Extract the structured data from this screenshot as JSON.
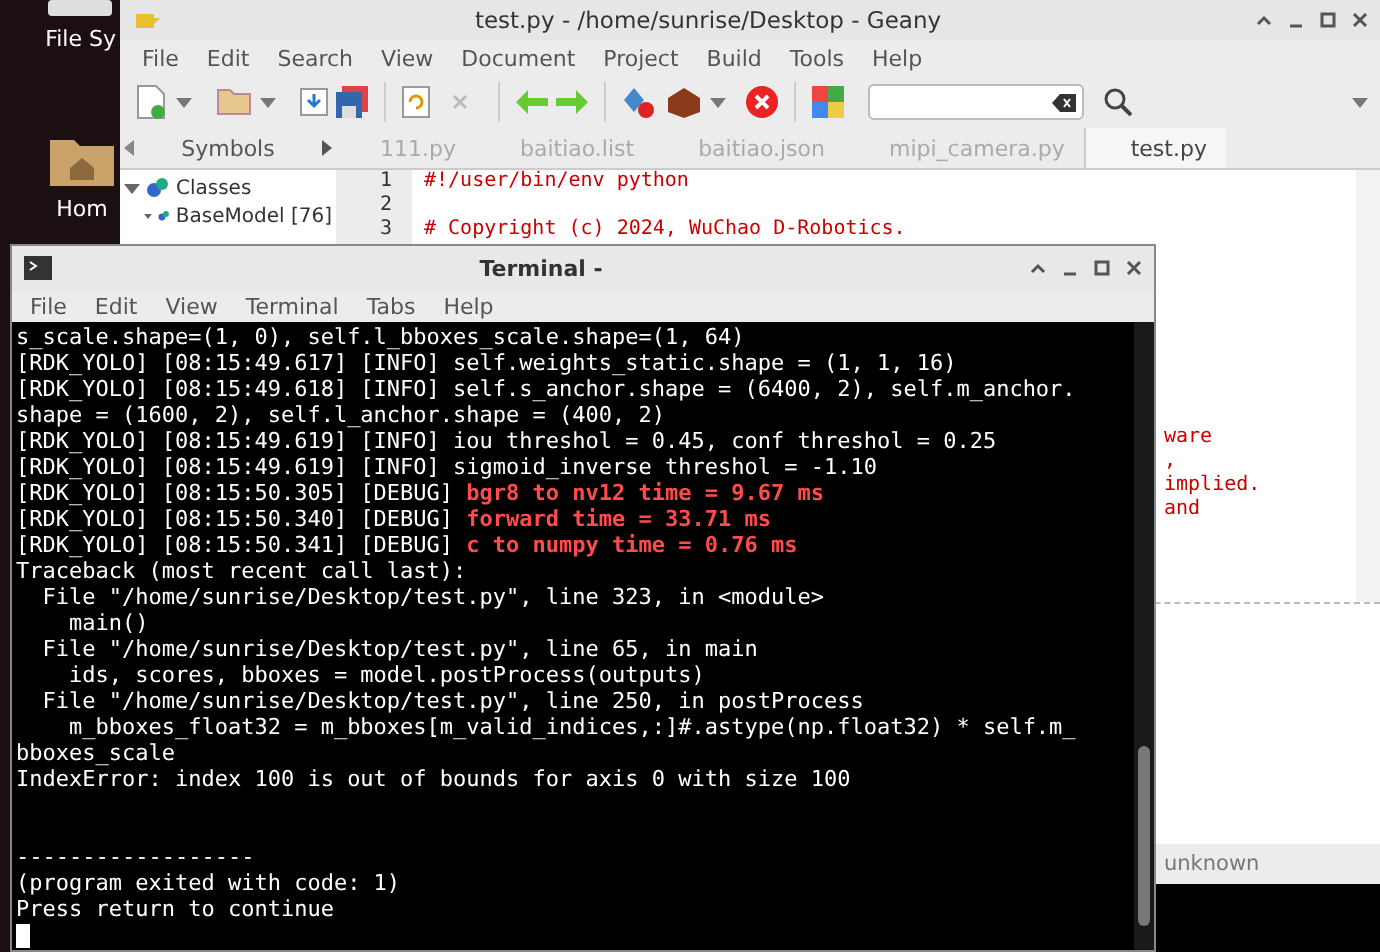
{
  "desktop": {
    "icons": [
      {
        "label": "File Sy",
        "kind": "drive"
      },
      {
        "label": "Hom",
        "kind": "home"
      }
    ]
  },
  "geany": {
    "title": "test.py - /home/sunrise/Desktop - Geany",
    "menu": [
      "File",
      "Edit",
      "Search",
      "View",
      "Document",
      "Project",
      "Build",
      "Tools",
      "Help"
    ],
    "sidebar": {
      "tab": "Symbols",
      "tree": [
        {
          "label": "Classes",
          "expanded": true,
          "children": [
            {
              "label": "BaseModel [76]",
              "expanded": true
            }
          ]
        }
      ]
    },
    "tabs": [
      {
        "label": "111.py",
        "selected": false
      },
      {
        "label": "baitiao.list",
        "selected": false
      },
      {
        "label": "baitiao.json",
        "selected": false
      },
      {
        "label": "mipi_camera.py",
        "selected": false
      },
      {
        "label": "test.py",
        "selected": true
      }
    ],
    "editor": {
      "lines": [
        {
          "number": "1",
          "code": "#!/user/bin/env python"
        },
        {
          "number": "2"
        },
        {
          "number": "3",
          "code": "# Copyright (c) 2024, WuChao D-Robotics."
        }
      ],
      "fragments": [
        "ware",
        ",",
        "implied.",
        "and"
      ]
    },
    "status": "unknown"
  },
  "terminal": {
    "title": "Terminal -",
    "menu": [
      "File",
      "Edit",
      "View",
      "Terminal",
      "Tabs",
      "Help"
    ],
    "lines": [
      {
        "text": "s_scale.shape=(1, 0), self.l_bboxes_scale.shape=(1, 64)"
      },
      {
        "text": "[RDK_YOLO] [08:15:49.617] [INFO] self.weights_static.shape = (1, 1, 16)"
      },
      {
        "text": "[RDK_YOLO] [08:15:49.618] [INFO] self.s_anchor.shape = (6400, 2), self.m_anchor."
      },
      {
        "text": "shape = (1600, 2), self.l_anchor.shape = (400, 2)"
      },
      {
        "text": "[RDK_YOLO] [08:15:49.619] [INFO] iou threshol = 0.45, conf threshol = 0.25"
      },
      {
        "text": "[RDK_YOLO] [08:15:49.619] [INFO] sigmoid_inverse threshol = -1.10"
      },
      {
        "text": "[RDK_YOLO] [08:15:50.305] [DEBUG] ",
        "highlight": "bgr8 to nv12 time = 9.67 ms"
      },
      {
        "text": "[RDK_YOLO] [08:15:50.340] [DEBUG] ",
        "highlight": "forward time = 33.71 ms"
      },
      {
        "text": "[RDK_YOLO] [08:15:50.341] [DEBUG] ",
        "highlight": "c to numpy time = 0.76 ms"
      },
      {
        "text": "Traceback (most recent call last):"
      },
      {
        "text": "  File \"/home/sunrise/Desktop/test.py\", line 323, in <module>"
      },
      {
        "text": "    main()"
      },
      {
        "text": "  File \"/home/sunrise/Desktop/test.py\", line 65, in main"
      },
      {
        "text": "    ids, scores, bboxes = model.postProcess(outputs)"
      },
      {
        "text": "  File \"/home/sunrise/Desktop/test.py\", line 250, in postProcess"
      },
      {
        "text": "    m_bboxes_float32 = m_bboxes[m_valid_indices,:]#.astype(np.float32) * self.m_"
      },
      {
        "text": "bboxes_scale"
      },
      {
        "text": "IndexError: index 100 is out of bounds for axis 0 with size 100"
      }
    ],
    "footer": [
      "------------------",
      "(program exited with code: 1)",
      "Press return to continue"
    ]
  }
}
